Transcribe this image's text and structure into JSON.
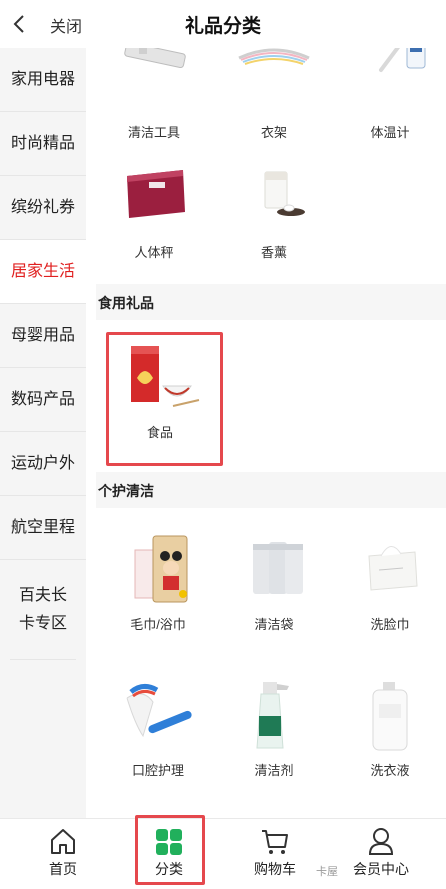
{
  "header": {
    "back_icon": "chevron-left-icon",
    "close_label": "关闭",
    "title": "礼品分类"
  },
  "sidebar": {
    "items": [
      {
        "label": "家用电器",
        "active": false
      },
      {
        "label": "时尚精品",
        "active": false
      },
      {
        "label": "缤纷礼券",
        "active": false
      },
      {
        "label": "居家生活",
        "active": true
      },
      {
        "label": "母婴用品",
        "active": false
      },
      {
        "label": "数码产品",
        "active": false
      },
      {
        "label": "运动户外",
        "active": false
      },
      {
        "label": "航空里程",
        "active": false
      },
      {
        "label": "百夫长卡专区",
        "active": false
      }
    ],
    "active_color": "#e02020"
  },
  "home_living": {
    "items": [
      {
        "label": "清洁工具",
        "icon": "cleaning-tool-icon"
      },
      {
        "label": "衣架",
        "icon": "hanger-icon"
      },
      {
        "label": "体温计",
        "icon": "thermometer-icon"
      },
      {
        "label": "人体秤",
        "icon": "scale-icon"
      },
      {
        "label": "香薰",
        "icon": "aroma-candle-icon"
      }
    ]
  },
  "food": {
    "heading": "食用礼品",
    "items": [
      {
        "label": "食品",
        "icon": "rice-bag-icon"
      }
    ]
  },
  "care": {
    "heading": "个护清洁",
    "items": [
      {
        "label": "毛巾/浴巾",
        "icon": "towel-icon"
      },
      {
        "label": "清洁袋",
        "icon": "trash-bag-icon"
      },
      {
        "label": "洗脸巾",
        "icon": "tissue-box-icon"
      },
      {
        "label": "口腔护理",
        "icon": "toothbrush-icon"
      },
      {
        "label": "清洁剂",
        "icon": "spray-bottle-icon"
      },
      {
        "label": "洗衣液",
        "icon": "detergent-icon"
      }
    ]
  },
  "bottom_nav": {
    "items": [
      {
        "label": "首页",
        "icon": "home-icon",
        "active": false
      },
      {
        "label": "分类",
        "icon": "category-grid-icon",
        "active": true
      },
      {
        "label": "购物车",
        "icon": "cart-icon",
        "active": false
      },
      {
        "label": "会员中心",
        "icon": "user-icon",
        "active": false
      }
    ],
    "accent": "#21b05c"
  },
  "watermark": "卡屋",
  "highlight_color": "#e5484d"
}
